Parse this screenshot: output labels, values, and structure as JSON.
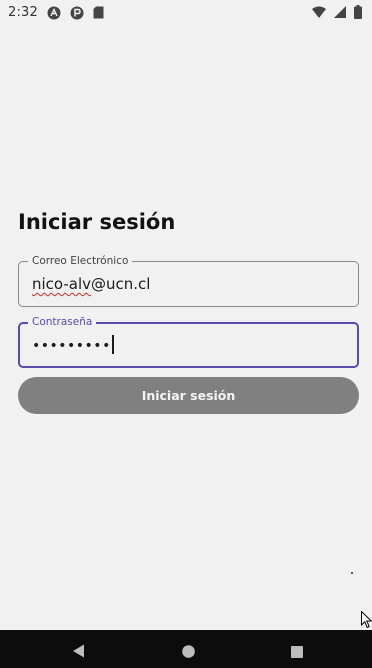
{
  "status_bar": {
    "time": "2:32",
    "icons": [
      "notification-a-icon",
      "notification-p-icon",
      "sd-card-icon",
      "wifi-icon",
      "signal-icon",
      "battery-icon"
    ]
  },
  "login": {
    "title": "Iniciar sesión",
    "email": {
      "label": "Correo Electrónico",
      "value_misspelled": "nico-alv",
      "value_rest": "@ucn.cl"
    },
    "password": {
      "label": "Contraseña",
      "masked_value": "•••••••••"
    },
    "submit_label": "Iniciar sesión"
  },
  "nav_bar": {
    "buttons": [
      "back",
      "home",
      "recents"
    ]
  },
  "colors": {
    "background": "#f1f1f1",
    "accent": "#5b4bab",
    "button_disabled": "#808080",
    "nav_bar": "#0c0c0c"
  }
}
